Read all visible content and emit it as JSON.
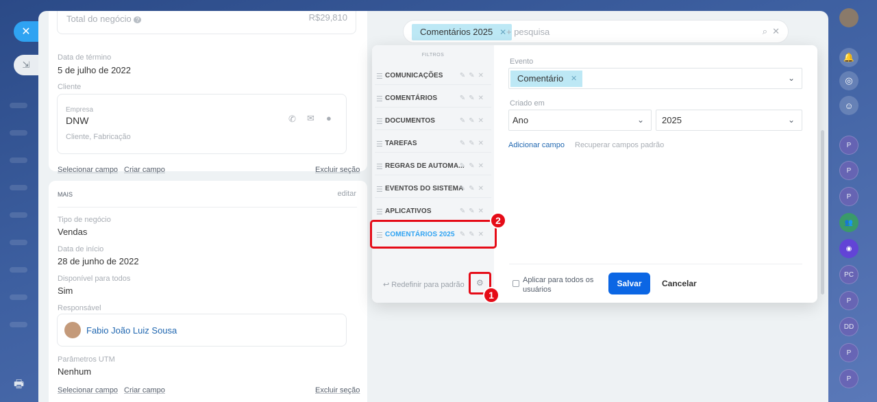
{
  "left_card": {
    "total_label": "Total do negócio",
    "total_value": "R$29,810",
    "end_date_label": "Data de término",
    "end_date_value": "5 de julho de 2022",
    "client_label": "Cliente",
    "company_label": "Empresa",
    "company_name": "DNW",
    "company_tags": "Cliente, Fabricação",
    "select_field": "Selecionar campo",
    "create_field": "Criar campo",
    "delete_section": "Excluir seção"
  },
  "more_card": {
    "title": "MAIS",
    "edit": "editar",
    "deal_type_label": "Tipo de negócio",
    "deal_type_value": "Vendas",
    "start_date_label": "Data de início",
    "start_date_value": "28 de junho de 2022",
    "available_label": "Disponível para todos",
    "available_value": "Sim",
    "responsible_label": "Responsável",
    "responsible_name": "Fabio João Luiz Sousa",
    "utm_label": "Parâmetros UTM",
    "utm_value": "Nenhum",
    "select_field": "Selecionar campo",
    "create_field": "Criar campo",
    "delete_section": "Excluir seção"
  },
  "search": {
    "active_tag": "Comentários 2025",
    "placeholder": "+ pesquisa"
  },
  "filters": {
    "heading": "FILTROS",
    "items": [
      {
        "label": "COMUNICAÇÕES"
      },
      {
        "label": "COMENTÁRIOS"
      },
      {
        "label": "DOCUMENTOS"
      },
      {
        "label": "TAREFAS"
      },
      {
        "label": "REGRAS DE AUTOMA..."
      },
      {
        "label": "EVENTOS DO SISTEMA"
      },
      {
        "label": "APLICATIVOS"
      },
      {
        "label": "COMENTÁRIOS 2025"
      }
    ],
    "reset": "Redefinir para padrão"
  },
  "form": {
    "event_label": "Evento",
    "event_chip": "Comentário",
    "created_label": "Criado em",
    "period_value": "Ano",
    "year_value": "2025",
    "add_field": "Adicionar campo",
    "restore_fields": "Recuperar campos padrão",
    "apply_all": "Aplicar para todos os usuários",
    "save": "Salvar",
    "cancel": "Cancelar"
  },
  "callouts": {
    "one": "1",
    "two": "2"
  },
  "right_rail": {
    "avatars": [
      "P",
      "P",
      "P",
      "P",
      "PC",
      "P",
      "DD",
      "P",
      "P"
    ]
  },
  "colors": {
    "accent": "#2fa3f2",
    "save": "#0b66e4",
    "highlight": "#e50b17",
    "chip": "#bde8f5"
  }
}
